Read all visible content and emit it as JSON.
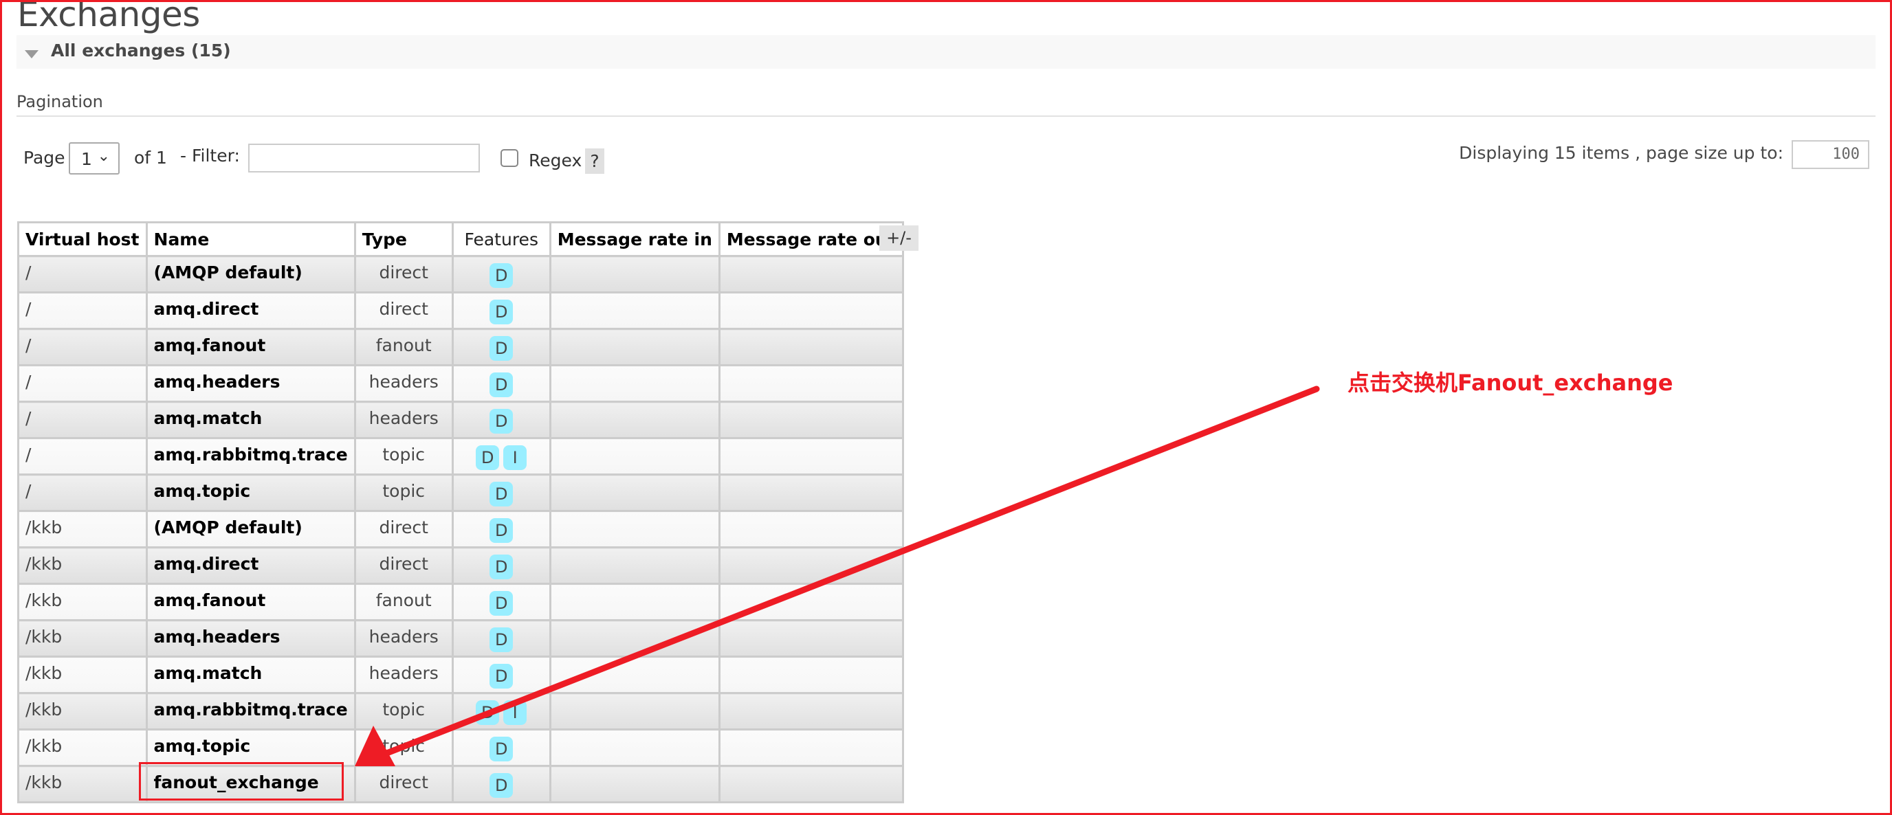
{
  "page": {
    "title": "Exchanges",
    "section_title": "All exchanges (15)"
  },
  "pagination": {
    "heading": "Pagination",
    "page_label": "Page",
    "page_value": "1",
    "of_label": "of 1",
    "filter_label": "- Filter:",
    "filter_value": "",
    "filter_placeholder": "",
    "regex_label": "Regex",
    "regex_checked": false,
    "help_label": "?",
    "display_label": "Displaying 15 items , page size up to:",
    "page_size_value": "100"
  },
  "table": {
    "columns": [
      "Virtual host",
      "Name",
      "Type",
      "Features",
      "Message rate in",
      "Message rate out"
    ],
    "toggle_columns_label": "+/-",
    "rows": [
      {
        "vhost": "/",
        "name": "(AMQP default)",
        "type": "direct",
        "features": [
          "D"
        ],
        "rate_in": "",
        "rate_out": ""
      },
      {
        "vhost": "/",
        "name": "amq.direct",
        "type": "direct",
        "features": [
          "D"
        ],
        "rate_in": "",
        "rate_out": ""
      },
      {
        "vhost": "/",
        "name": "amq.fanout",
        "type": "fanout",
        "features": [
          "D"
        ],
        "rate_in": "",
        "rate_out": ""
      },
      {
        "vhost": "/",
        "name": "amq.headers",
        "type": "headers",
        "features": [
          "D"
        ],
        "rate_in": "",
        "rate_out": ""
      },
      {
        "vhost": "/",
        "name": "amq.match",
        "type": "headers",
        "features": [
          "D"
        ],
        "rate_in": "",
        "rate_out": ""
      },
      {
        "vhost": "/",
        "name": "amq.rabbitmq.trace",
        "type": "topic",
        "features": [
          "D",
          "I"
        ],
        "rate_in": "",
        "rate_out": ""
      },
      {
        "vhost": "/",
        "name": "amq.topic",
        "type": "topic",
        "features": [
          "D"
        ],
        "rate_in": "",
        "rate_out": ""
      },
      {
        "vhost": "/kkb",
        "name": "(AMQP default)",
        "type": "direct",
        "features": [
          "D"
        ],
        "rate_in": "",
        "rate_out": ""
      },
      {
        "vhost": "/kkb",
        "name": "amq.direct",
        "type": "direct",
        "features": [
          "D"
        ],
        "rate_in": "",
        "rate_out": ""
      },
      {
        "vhost": "/kkb",
        "name": "amq.fanout",
        "type": "fanout",
        "features": [
          "D"
        ],
        "rate_in": "",
        "rate_out": ""
      },
      {
        "vhost": "/kkb",
        "name": "amq.headers",
        "type": "headers",
        "features": [
          "D"
        ],
        "rate_in": "",
        "rate_out": ""
      },
      {
        "vhost": "/kkb",
        "name": "amq.match",
        "type": "headers",
        "features": [
          "D"
        ],
        "rate_in": "",
        "rate_out": ""
      },
      {
        "vhost": "/kkb",
        "name": "amq.rabbitmq.trace",
        "type": "topic",
        "features": [
          "D",
          "I"
        ],
        "rate_in": "",
        "rate_out": ""
      },
      {
        "vhost": "/kkb",
        "name": "amq.topic",
        "type": "topic",
        "features": [
          "D"
        ],
        "rate_in": "",
        "rate_out": ""
      },
      {
        "vhost": "/kkb",
        "name": "fanout_exchange",
        "type": "direct",
        "features": [
          "D"
        ],
        "rate_in": "",
        "rate_out": ""
      }
    ]
  },
  "annotation": {
    "text": "点击交换机Fanout_exchange",
    "color": "#ee1c25",
    "target_row": "fanout_exchange"
  },
  "colors": {
    "feature_badge": "#99eeff",
    "annotation_red": "#ee1c25"
  }
}
